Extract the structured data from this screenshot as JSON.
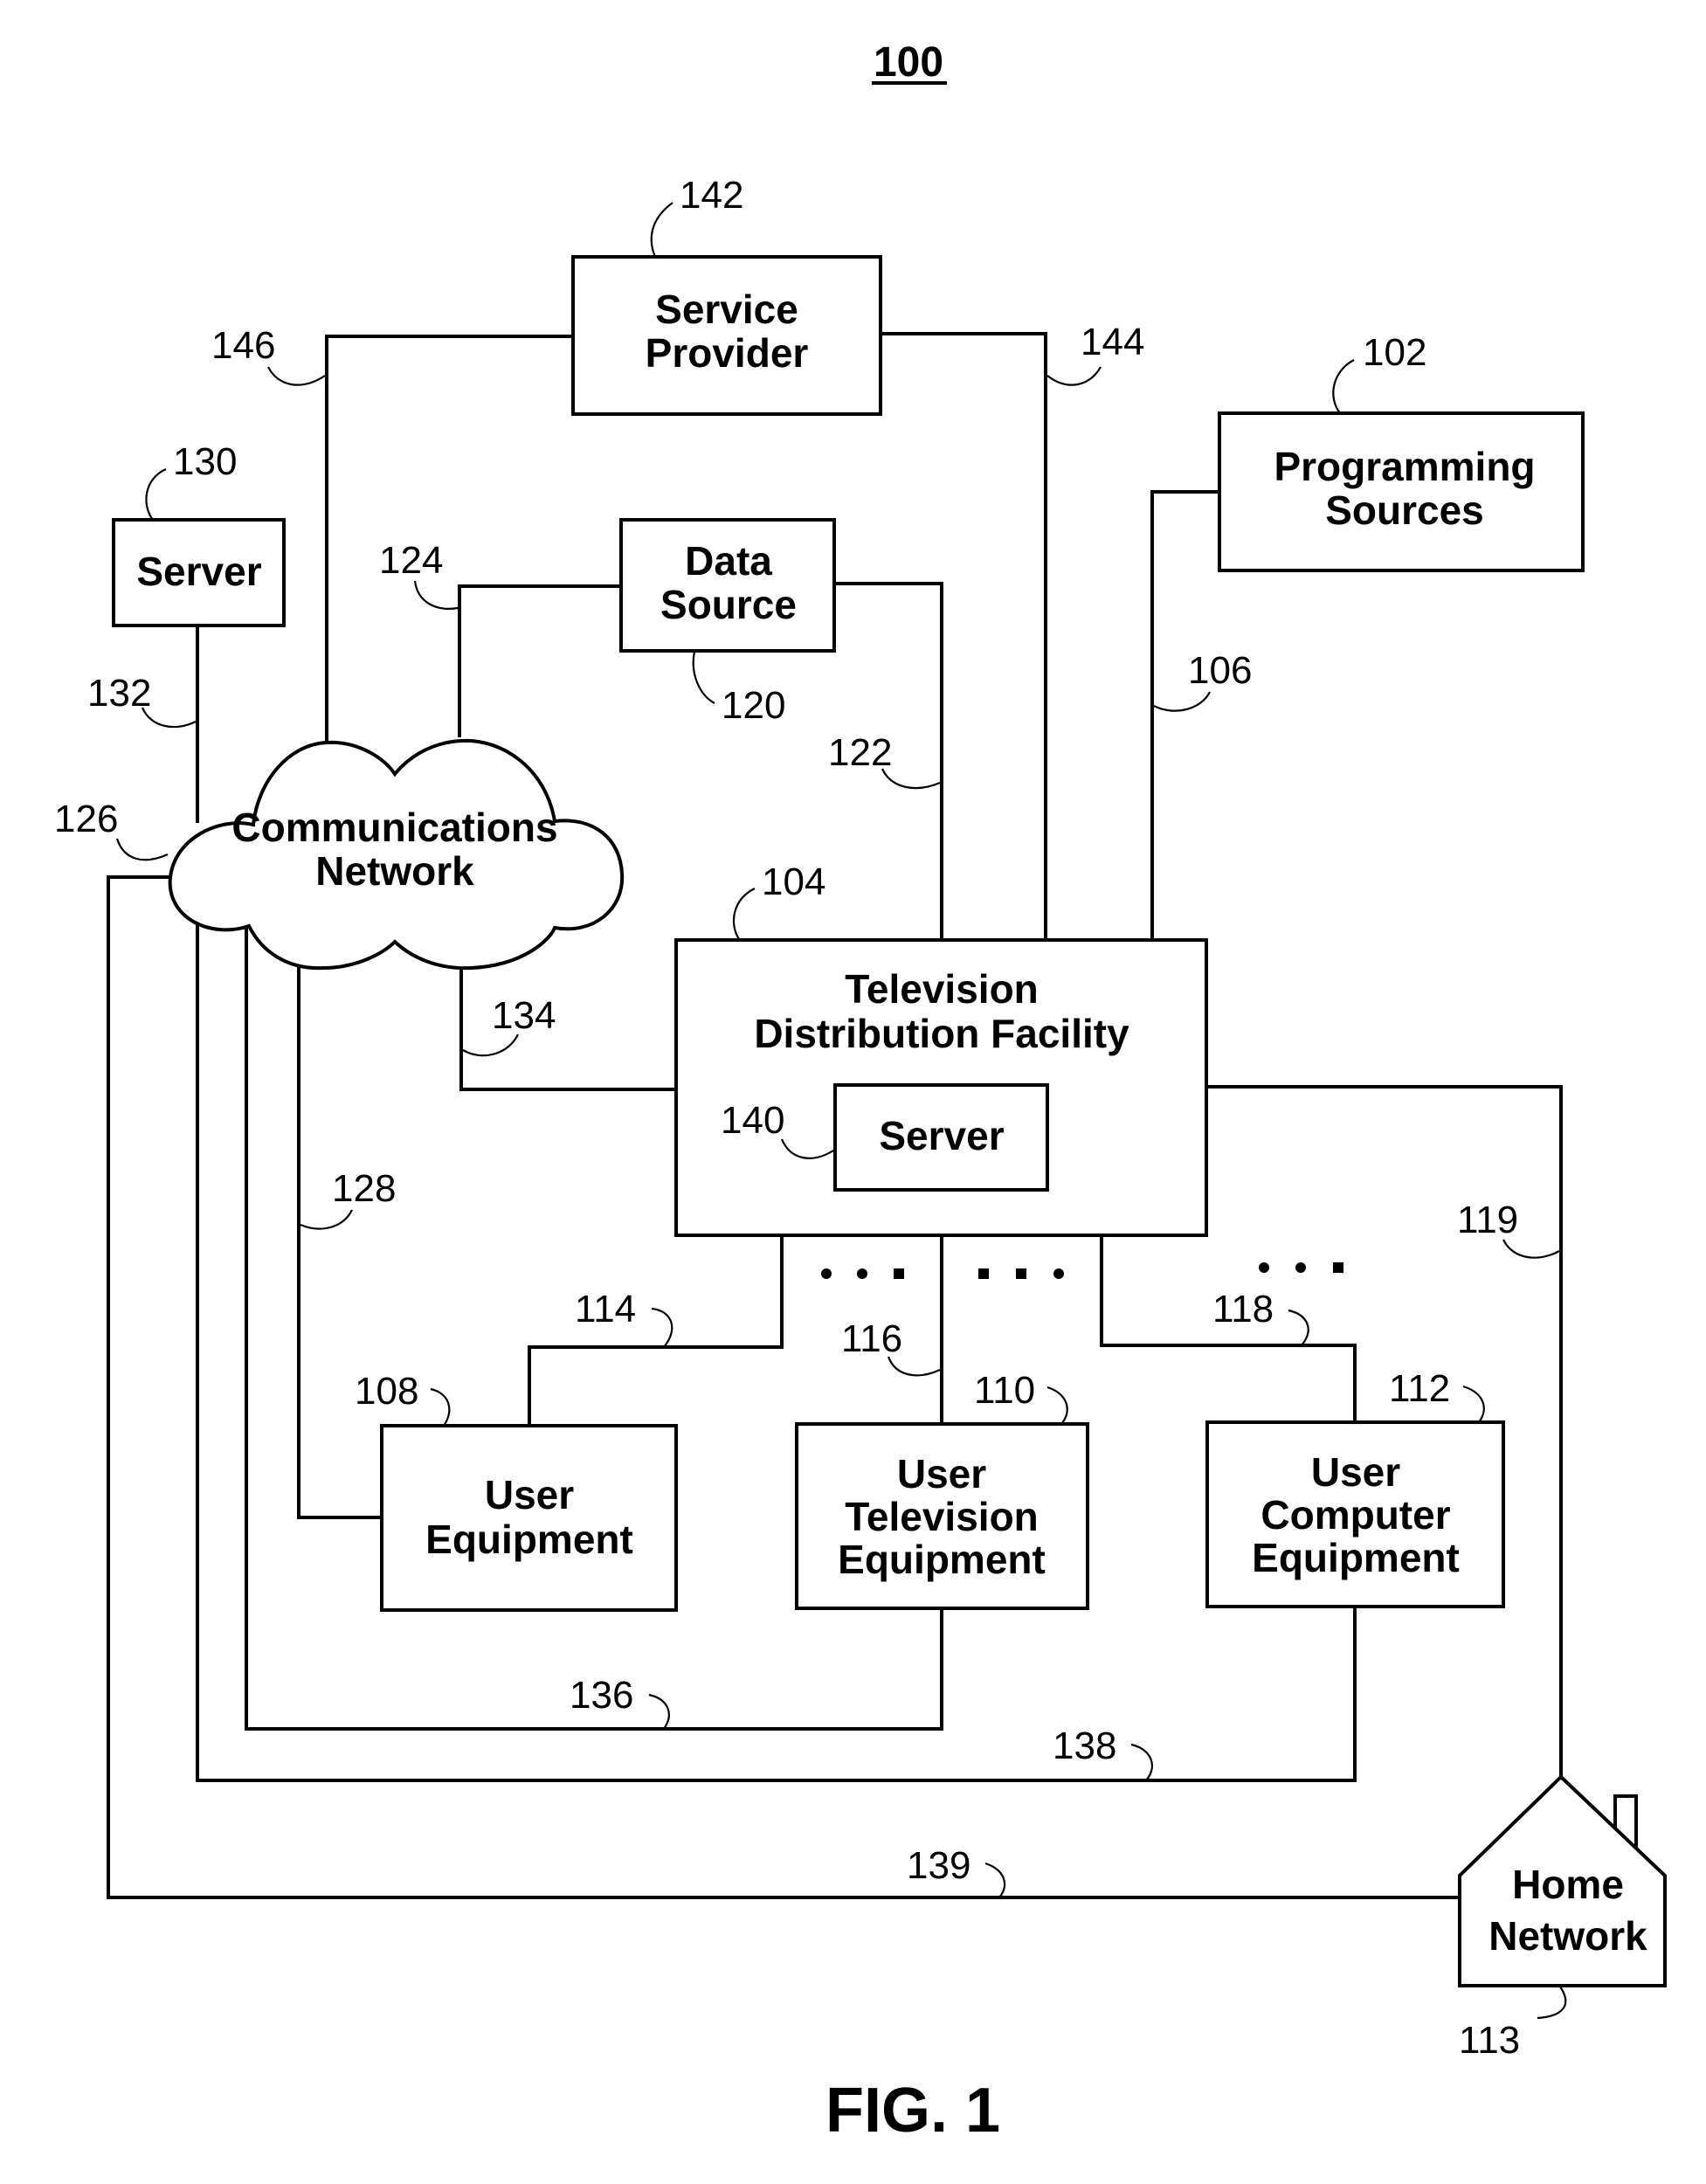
{
  "figure": {
    "number_label": "100",
    "caption": "FIG. 1"
  },
  "nodes": {
    "service_provider": {
      "ref": "142",
      "lines": [
        "Service",
        "Provider"
      ]
    },
    "programming_sources": {
      "ref": "102",
      "lines": [
        "Programming",
        "Sources"
      ]
    },
    "server_external": {
      "ref": "130",
      "lines": [
        "Server"
      ]
    },
    "data_source": {
      "ref": "120",
      "lines": [
        "Data",
        "Source"
      ]
    },
    "communications_network": {
      "ref": "126",
      "lines": [
        "Communications",
        "Network"
      ]
    },
    "television_distribution_facility": {
      "ref": "104",
      "lines": [
        "Television",
        "Distribution Facility"
      ]
    },
    "server_internal": {
      "ref": "140",
      "lines": [
        "Server"
      ]
    },
    "user_equipment": {
      "ref": "108",
      "lines": [
        "User",
        "Equipment"
      ]
    },
    "user_television_equipment": {
      "ref": "110",
      "lines": [
        "User",
        "Television",
        "Equipment"
      ]
    },
    "user_computer_equipment": {
      "ref": "112",
      "lines": [
        "User",
        "Computer",
        "Equipment"
      ]
    },
    "home_network": {
      "ref": "113",
      "lines": [
        "Home",
        "Network"
      ]
    }
  },
  "links": {
    "l146": "146",
    "l144": "144",
    "l106": "106",
    "l124": "124",
    "l122": "122",
    "l132": "132",
    "l134": "134",
    "l128": "128",
    "l114": "114",
    "l116": "116",
    "l118": "118",
    "l119": "119",
    "l136": "136",
    "l138": "138",
    "l139": "139"
  },
  "ellipsis": "• • •"
}
